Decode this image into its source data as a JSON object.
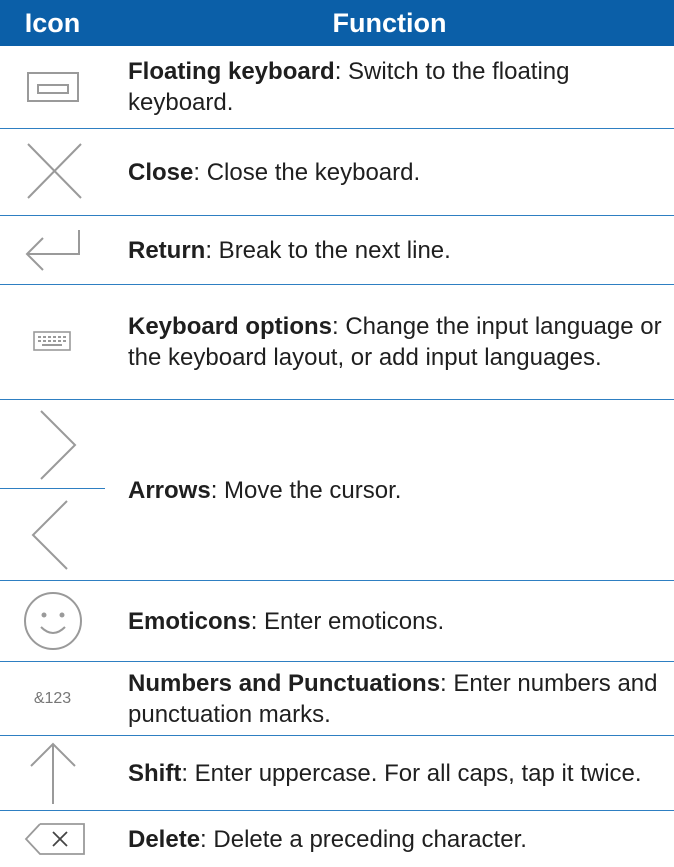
{
  "header": {
    "icon_col": "Icon",
    "function_col": "Function"
  },
  "rows": [
    {
      "icon": "floating-keyboard-icon",
      "title": "Floating keyboard",
      "desc": ": Switch to the floating keyboard."
    },
    {
      "icon": "close-icon",
      "title": "Close",
      "desc": ": Close the keyboard."
    },
    {
      "icon": "return-icon",
      "title": "Return",
      "desc": ": Break to the next line."
    },
    {
      "icon": "keyboard-options-icon",
      "title": "Keyboard options",
      "desc": ": Change the input language or the keyboard layout, or add input languages."
    },
    {
      "icon": "arrows-icon",
      "title": "Arrows",
      "desc": ": Move the cursor."
    },
    {
      "icon": "emoticons-icon",
      "title": "Emoticons",
      "desc": ": Enter emoticons."
    },
    {
      "icon": "numbers-icon",
      "icon_text": "&123",
      "title": "Numbers and Punctuations",
      "desc": ": Enter numbers and punctuation marks."
    },
    {
      "icon": "shift-icon",
      "title": "Shift",
      "desc": ": Enter uppercase. For all caps, tap it twice."
    },
    {
      "icon": "delete-icon",
      "title": "Delete",
      "desc": ": Delete a preceding character."
    }
  ],
  "colors": {
    "header_bg": "#0b5fa8",
    "divider": "#2e7fc2",
    "icon_gray": "#9a9a9a"
  }
}
